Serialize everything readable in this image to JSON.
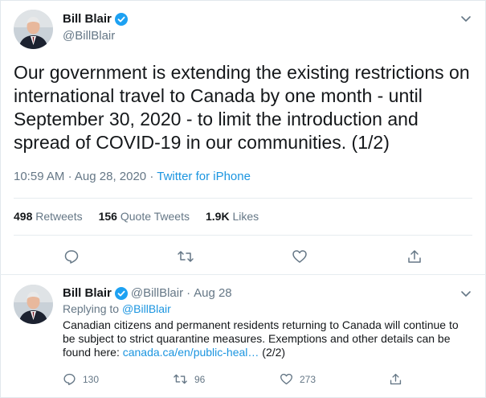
{
  "tweet": {
    "author_name": "Bill Blair",
    "author_handle": "@BillBlair",
    "text": "Our government is extending the existing restrictions on international travel to Canada by one month - until September 30, 2020 - to limit the introduction and spread of COVID-19 in our communities. (1/2)",
    "time": "10:59 AM",
    "date": "Aug 28, 2020",
    "sep": "·",
    "source": "Twitter for iPhone",
    "stats": {
      "retweets_count": "498",
      "retweets_label": "Retweets",
      "quotes_count": "156",
      "quotes_label": "Quote Tweets",
      "likes_count": "1.9K",
      "likes_label": "Likes"
    }
  },
  "reply": {
    "author_name": "Bill Blair",
    "author_handle": "@BillBlair",
    "sep": "·",
    "date": "Aug 28",
    "replying_prefix": "Replying to",
    "replying_handle": "@BillBlair",
    "text_before_link": "Canadian citizens and permanent residents returning to Canada will continue to be subject to strict quarantine measures. Exemptions and other details can be found here:",
    "link_text": "canada.ca/en/public-heal…",
    "text_after_link": "(2/2)",
    "reply_count": "130",
    "retweet_count": "96",
    "like_count": "273"
  },
  "colors": {
    "accent": "#1da1f2",
    "link": "#1b95e0",
    "muted": "#657786",
    "text": "#14171a"
  },
  "icons": [
    "verified-badge-icon",
    "chevron-down-icon",
    "reply-icon",
    "retweet-icon",
    "like-icon",
    "share-icon"
  ]
}
